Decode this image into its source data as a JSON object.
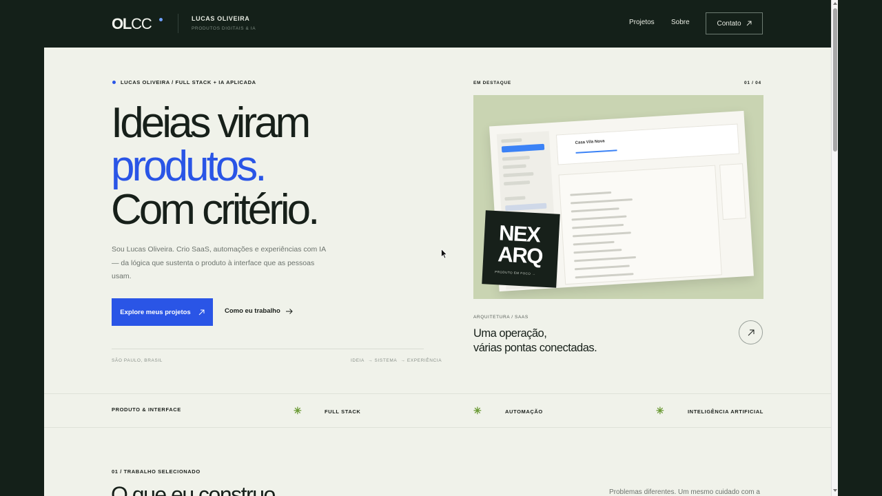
{
  "header": {
    "logo_bold": "OL",
    "logo_light": "CC",
    "brand_name": "LUCAS OLIVEIRA",
    "brand_sub": "PRODUTOS DIGITAIS & IA",
    "nav": {
      "projetos": "Projetos",
      "sobre": "Sobre"
    },
    "contact_label": "Contato"
  },
  "hero": {
    "eyebrow": "LUCAS OLIVEIRA / FULL STACK + IA APLICADA",
    "title_line1": "Ideias viram",
    "title_line2": "produtos.",
    "title_line3": "Com critério.",
    "description": "Sou Lucas Oliveira. Crio SaaS, automações e experiências com IA — da lógica que sustenta o produto à interface que as pessoas usam.",
    "primary_cta": "Explore meus projetos",
    "secondary_cta": "Como eu trabalho",
    "location": "SÃO PAULO, BRASIL",
    "tags": [
      "IDEIA",
      "→ SISTEMA",
      "→ EXPERIÊNCIA"
    ]
  },
  "featured": {
    "label": "EM DESTAQUE",
    "counter": "01 / 04",
    "mock_project": "Casa Vila Nova",
    "badge_text": "NEX ARQ",
    "badge_sub": "PRODUTO EM FOCO →",
    "category": "ARQUITETURA / SAAS",
    "title_line1": "Uma operação,",
    "title_line2": "várias pontas conectadas."
  },
  "strip": {
    "items": [
      "PRODUTO & INTERFACE",
      "FULL STACK",
      "AUTOMAÇÃO",
      "INTELIGÊNCIA ARTIFICIAL"
    ]
  },
  "section": {
    "label": "01 / TRABALHO SELECIONADO",
    "title": "O que eu construo",
    "description": "Problemas diferentes. Um mesmo cuidado com a"
  },
  "colors": {
    "accent": "#2a55e6",
    "dark": "#142019",
    "background": "#f0f2ea",
    "asterisk": "#6a9a34"
  }
}
